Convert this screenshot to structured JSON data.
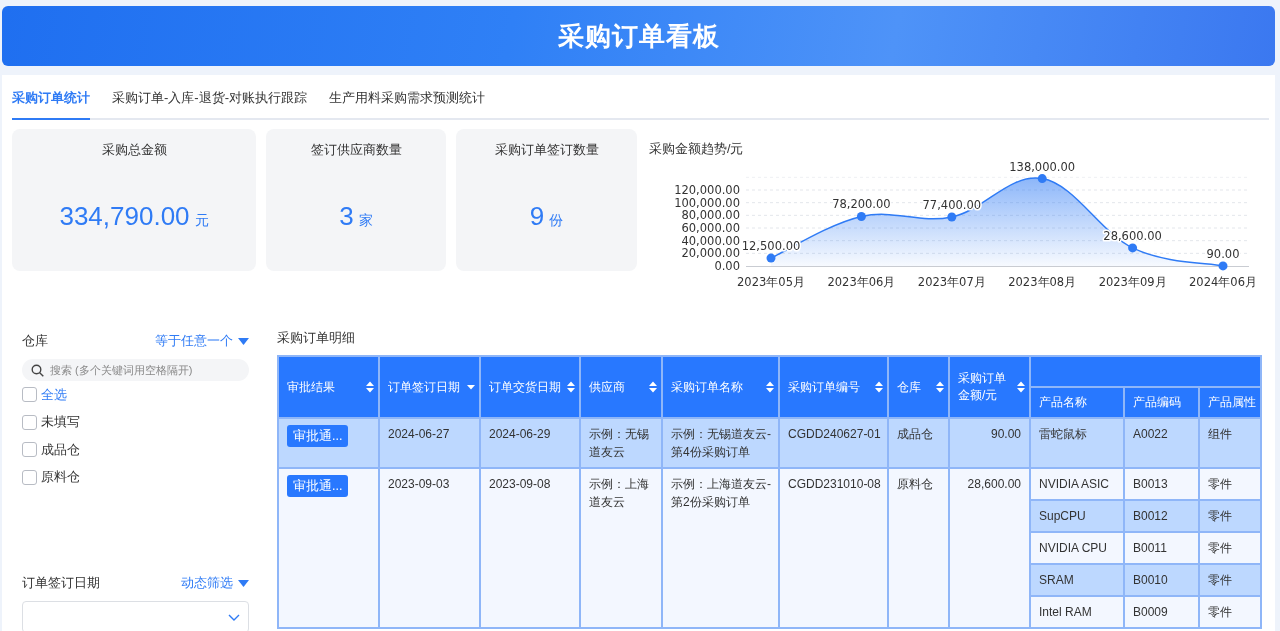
{
  "header": {
    "title": "采购订单看板"
  },
  "tabs": [
    {
      "label": "采购订单统计",
      "selected": true
    },
    {
      "label": "采购订单-入库-退货-对账执行跟踪",
      "selected": false
    },
    {
      "label": "生产用料采购需求预测统计",
      "selected": false
    }
  ],
  "stats": [
    {
      "label": "采购总金额",
      "value": "334,790.00",
      "unit": "元"
    },
    {
      "label": "签订供应商数量",
      "value": "3",
      "unit": "家"
    },
    {
      "label": "采购订单签订数量",
      "value": "9",
      "unit": "份"
    }
  ],
  "trend": {
    "title": "采购金额趋势/元",
    "chart_data": {
      "type": "area",
      "categories": [
        "2023年05月",
        "2023年06月",
        "2023年07月",
        "2023年08月",
        "2023年09月",
        "2024年06月"
      ],
      "series": [
        {
          "color": "#2f7bf5",
          "values": [
            12500,
            78200,
            77400,
            138000,
            28600,
            90
          ]
        }
      ],
      "grid": true,
      "ylim": [
        0,
        140000
      ],
      "yticks": [
        {
          "value": 0,
          "label": "0.00"
        },
        {
          "value": 20000,
          "label": "20,000.00"
        },
        {
          "value": 40000,
          "label": "40,000.00"
        },
        {
          "value": 60000,
          "label": "60,000.00"
        },
        {
          "value": 80000,
          "label": "80,000.00"
        },
        {
          "value": 100000,
          "label": "100,000.00"
        },
        {
          "value": 120000,
          "label": "120,000.00"
        }
      ],
      "value_labels": [
        "12,500.00",
        "78,200.00",
        "77,400.00",
        "138,000.00",
        "28,600.00",
        "90.00"
      ]
    }
  },
  "filters": [
    {
      "kind": "checklist",
      "label": "仓库",
      "mode": "等于任意一个",
      "placeholder": "搜索 (多个关键词用空格隔开)",
      "options": [
        {
          "label": "全选",
          "kind": "all",
          "checked": false
        },
        {
          "label": "未填写",
          "kind": "option",
          "checked": false
        },
        {
          "label": "成品仓",
          "kind": "option",
          "checked": false
        },
        {
          "label": "原料仓",
          "kind": "option",
          "checked": false
        }
      ]
    },
    {
      "kind": "dropdown",
      "label": "订单签订日期",
      "mode": "动态筛选"
    }
  ],
  "table": {
    "title": "采购订单明细",
    "columns": [
      {
        "label": "审批结果",
        "kind": "button",
        "sorted": false
      },
      {
        "label": "订单签订日期",
        "kind": "text",
        "sorted": true
      },
      {
        "label": "订单交货日期",
        "kind": "text",
        "sorted": false
      },
      {
        "label": "供应商",
        "kind": "text",
        "sorted": false
      },
      {
        "label": "采购订单名称",
        "kind": "text",
        "sorted": false
      },
      {
        "label": "采购订单编号",
        "kind": "text",
        "sorted": false
      },
      {
        "label": "仓库",
        "kind": "text",
        "sorted": false
      },
      {
        "label": "采购订单金额/元",
        "kind": "number",
        "sorted": false
      }
    ],
    "product_columns": [
      "产品名称",
      "产品编码",
      "产品属性"
    ],
    "rows": [
      {
        "highlighted": true,
        "cells": [
          "审批通...",
          "2024-06-27",
          "2024-06-29",
          "示例：无锡道友云",
          "示例：无锡道友云-第4份采购订单",
          "CGDD240627-01",
          "成品仓",
          "90.00"
        ],
        "products": [
          {
            "highlighted": true,
            "cells": [
              "雷蛇鼠标",
              "A0022",
              "组件"
            ]
          }
        ]
      },
      {
        "highlighted": false,
        "cells": [
          "审批通...",
          "2023-09-03",
          "2023-09-08",
          "示例：上海道友云",
          "示例：上海道友云-第2份采购订单",
          "CGDD231010-08",
          "原料仓",
          "28,600.00"
        ],
        "products": [
          {
            "highlighted": false,
            "cells": [
              "NVIDIA ASIC",
              "B0013",
              "零件"
            ]
          },
          {
            "highlighted": true,
            "cells": [
              "SupCPU",
              "B0012",
              "零件"
            ]
          },
          {
            "highlighted": false,
            "cells": [
              "NVIDIA CPU",
              "B0011",
              "零件"
            ]
          },
          {
            "highlighted": true,
            "cells": [
              "SRAM",
              "B0010",
              "零件"
            ]
          },
          {
            "highlighted": false,
            "cells": [
              "Intel RAM",
              "B0009",
              "零件"
            ]
          }
        ]
      }
    ]
  }
}
